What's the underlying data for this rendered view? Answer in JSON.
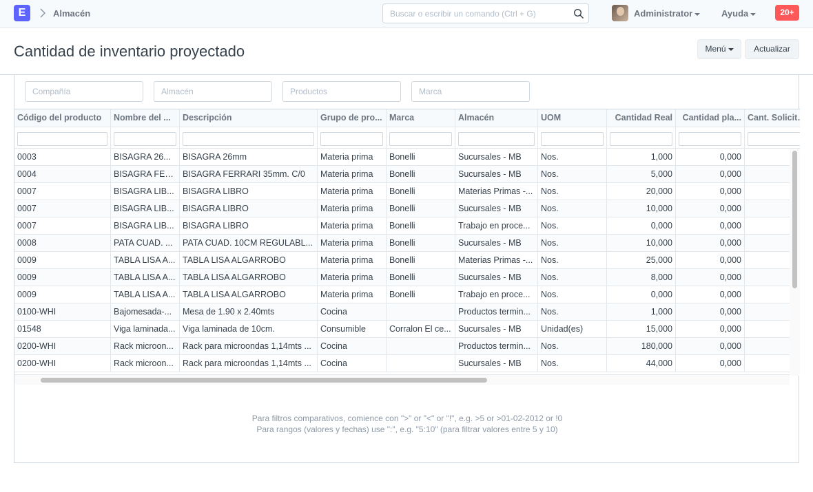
{
  "navbar": {
    "logo": "E",
    "breadcrumb": "Almacén",
    "search_placeholder": "Buscar o escribir un comando (Ctrl + G)",
    "user": "Administrator",
    "help": "Ayuda",
    "notifications": "20+"
  },
  "page": {
    "title": "Cantidad de inventario proyectado",
    "menu_label": "Menú",
    "refresh_label": "Actualizar"
  },
  "filters": [
    "Compañía",
    "Almacén",
    "Productos",
    "Marca"
  ],
  "columns": [
    "Código del producto",
    "Nombre del ...",
    "Descripción",
    "Grupo de pro...",
    "Marca",
    "Almacén",
    "UOM",
    "Cantidad Real",
    "Cantidad pla...",
    "Cant. Solicitada"
  ],
  "rows": [
    [
      "0003",
      "BISAGRA 26...",
      "BISAGRA 26mm",
      "Materia prima",
      "Bonelli",
      "Sucursales - MB",
      "Nos.",
      "1,000",
      "0,000"
    ],
    [
      "0004",
      "BISAGRA FER...",
      "BISAGRA FERRARI 35mm. C/0",
      "Materia prima",
      "Bonelli",
      "Sucursales - MB",
      "Nos.",
      "5,000",
      "0,000"
    ],
    [
      "0007",
      "BISAGRA LIB...",
      "BISAGRA LIBRO",
      "Materia prima",
      "Bonelli",
      "Materias Primas -...",
      "Nos.",
      "20,000",
      "0,000"
    ],
    [
      "0007",
      "BISAGRA LIB...",
      "BISAGRA LIBRO",
      "Materia prima",
      "Bonelli",
      "Sucursales - MB",
      "Nos.",
      "10,000",
      "0,000"
    ],
    [
      "0007",
      "BISAGRA LIB...",
      "BISAGRA LIBRO",
      "Materia prima",
      "Bonelli",
      "Trabajo en proce...",
      "Nos.",
      "0,000",
      "0,000"
    ],
    [
      "0008",
      "PATA CUAD. ...",
      "PATA CUAD. 10CM REGULABL...",
      "Materia prima",
      "Bonelli",
      "Sucursales - MB",
      "Nos.",
      "10,000",
      "0,000"
    ],
    [
      "0009",
      "TABLA LISA A...",
      "TABLA LISA ALGARROBO",
      "Materia prima",
      "Bonelli",
      "Materias Primas -...",
      "Nos.",
      "25,000",
      "0,000"
    ],
    [
      "0009",
      "TABLA LISA A...",
      "TABLA LISA ALGARROBO",
      "Materia prima",
      "Bonelli",
      "Sucursales - MB",
      "Nos.",
      "8,000",
      "0,000"
    ],
    [
      "0009",
      "TABLA LISA A...",
      "TABLA LISA ALGARROBO",
      "Materia prima",
      "Bonelli",
      "Trabajo en proce...",
      "Nos.",
      "0,000",
      "0,000"
    ],
    [
      "0100-WHI",
      "Bajomesada-...",
      "Mesa de 1.90 x 2.40mts",
      "Cocina",
      "",
      "Productos termin...",
      "Nos.",
      "1,000",
      "0,000"
    ],
    [
      "01548",
      "Viga laminada...",
      "Viga laminada de 10cm.",
      "Consumible",
      "Corralon El ce...",
      "Sucursales - MB",
      "Unidad(es)",
      "15,000",
      "0,000"
    ],
    [
      "0200-WHI",
      "Rack microon...",
      "Rack para microondas 1,14mts ...",
      "Cocina",
      "",
      "Productos termin...",
      "Nos.",
      "180,000",
      "0,000"
    ],
    [
      "0200-WHI",
      "Rack microon...",
      "Rack para microondas 1,14mts ...",
      "Cocina",
      "",
      "Sucursales - MB",
      "Nos.",
      "44,000",
      "0,000"
    ]
  ],
  "help_lines": [
    "Para filtros comparativos, comience con \">\" or \"<\" or \"!\", e.g. >5 or >01-02-2012 or !0",
    "Para rangos (valores y fechas) use \":\", e.g. \"5:10\" (para filtrar valores entre 5 y 10)"
  ],
  "colors": {
    "accent": "#5e64ff",
    "badge": "#ff5858"
  }
}
